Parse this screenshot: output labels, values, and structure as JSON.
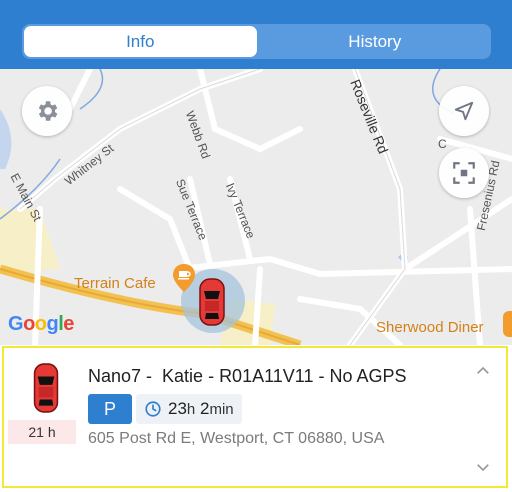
{
  "tabs": [
    {
      "label": "Info",
      "active": true
    },
    {
      "label": "History",
      "active": false
    }
  ],
  "map": {
    "roads": {
      "webb": "Webb Rd",
      "roseville": "Roseville Rd",
      "whitney": "Whitney St",
      "emain": "E Main St",
      "sue": "Sue Terrace",
      "ivy": "Ivy Terrace",
      "fresenius": "Fresenius Rd",
      "c": "C"
    },
    "pois": {
      "terrain_cafe": "Terrain Cafe",
      "sherwood_diner": "Sherwood Diner"
    },
    "attribution": [
      "G",
      "o",
      "o",
      "g",
      "l",
      "e"
    ],
    "buttons": [
      "gear-icon",
      "navigation-arrow-icon",
      "recenter-frame-icon"
    ]
  },
  "vehicle": {
    "title": "Nano7 -  Katie - R01A11V11 - No AGPS",
    "status_badge": "P",
    "duration": {
      "h": "23",
      "h_unit": "h",
      "m": "2",
      "m_unit": "min"
    },
    "address": "605 Post Rd E, Westport, CT 06880, USA",
    "age": "21 h"
  },
  "colors": {
    "header": "#2f7fd1",
    "accent": "#2f7fd1",
    "car": "#e53935",
    "poi": "#d4811a",
    "highlight": "#f2e83a"
  }
}
